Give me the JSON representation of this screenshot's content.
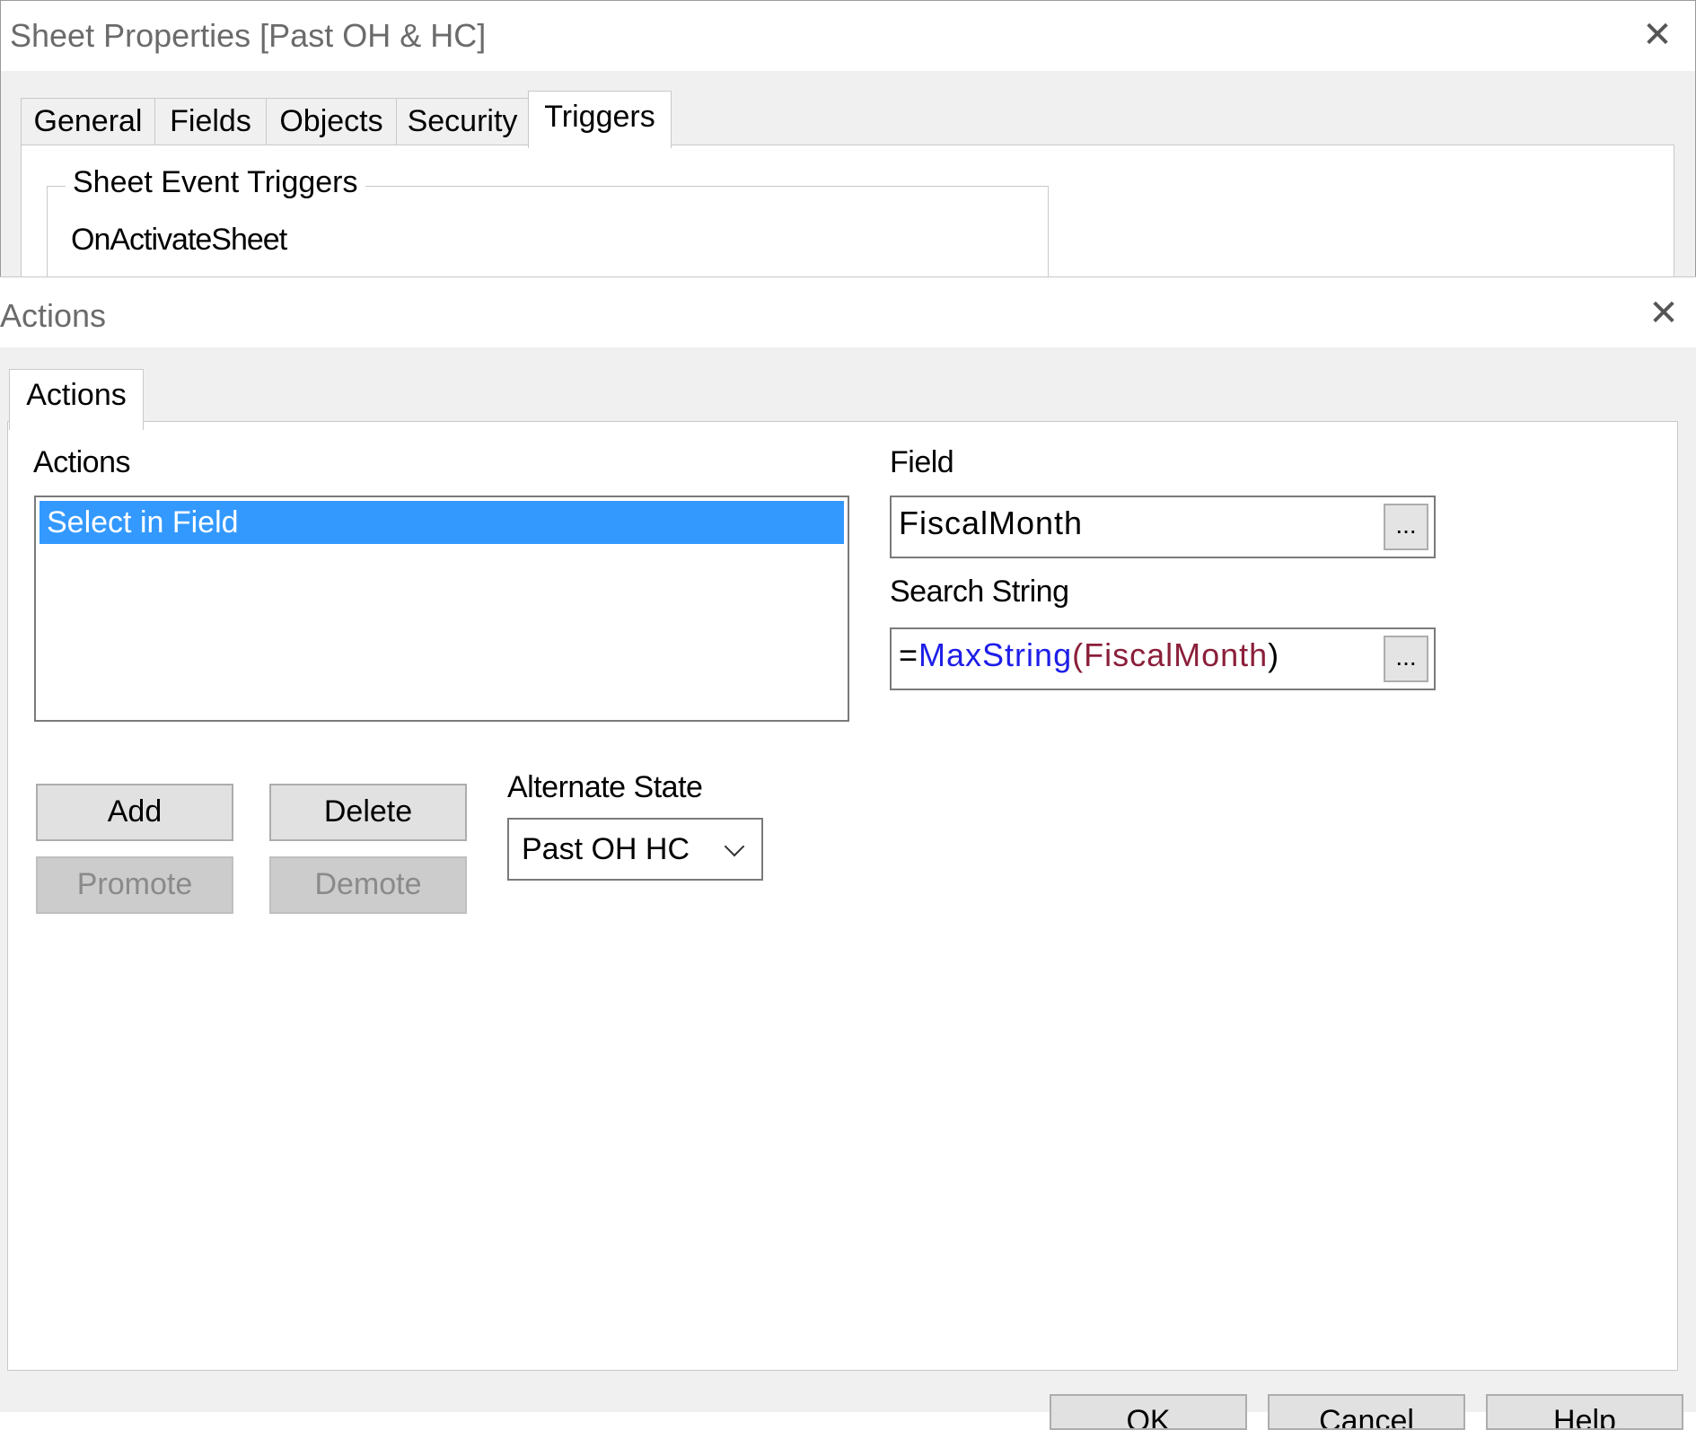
{
  "sheet_properties": {
    "title": "Sheet Properties [Past OH & HC]",
    "close_glyph": "✕",
    "tabs": [
      {
        "label": "General"
      },
      {
        "label": "Fields"
      },
      {
        "label": "Objects"
      },
      {
        "label": "Security"
      },
      {
        "label": "Triggers"
      }
    ],
    "active_tab": "Triggers",
    "group_title": "Sheet Event Triggers",
    "event_label": "OnActivateSheet"
  },
  "actions_dialog": {
    "title": "Actions",
    "close_glyph": "✕",
    "tab_label": "Actions",
    "actions_label": "Actions",
    "actions_list": [
      {
        "label": "Select in Field",
        "selected": true
      }
    ],
    "field": {
      "label": "Field",
      "value": "FiscalMonth",
      "browse_label": "..."
    },
    "search_string": {
      "label": "Search String",
      "value": "=MaxString(FiscalMonth)",
      "tokens": {
        "equals": "=",
        "function": "MaxString",
        "open_paren": "(",
        "argument": "FiscalMonth",
        "close_paren": ")"
      },
      "browse_label": "..."
    },
    "buttons": {
      "add": "Add",
      "delete": "Delete",
      "promote": "Promote",
      "demote": "Demote"
    },
    "alternate_state": {
      "label": "Alternate State",
      "value": "Past OH HC"
    },
    "footer_buttons": [
      "OK",
      "Cancel",
      "Help"
    ],
    "colors": {
      "selection": "#3399ff",
      "function_token": "#1e1ee8",
      "argument_token": "#8b1f3a"
    }
  }
}
